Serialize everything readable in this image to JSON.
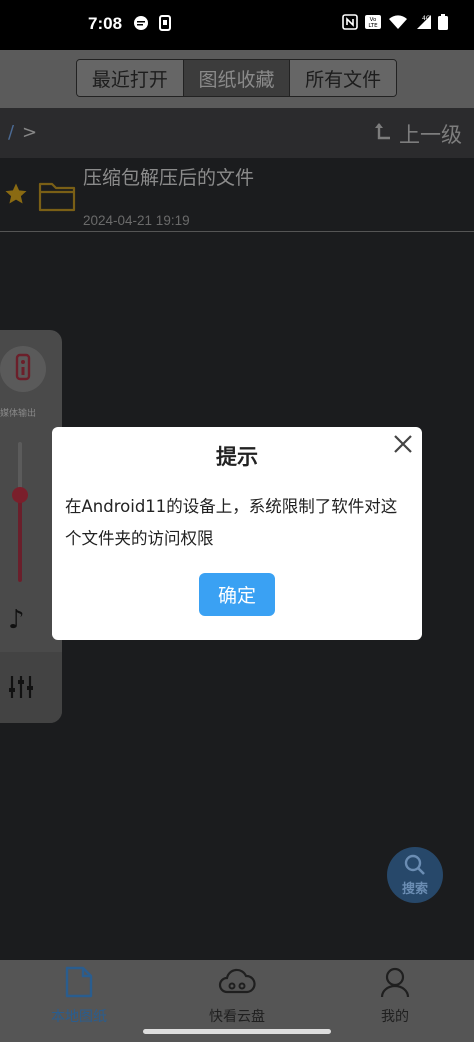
{
  "status_bar": {
    "time": "7:08",
    "network": "4G",
    "lte_badge": "Vo LTE"
  },
  "top_tabs": [
    {
      "label": "最近打开",
      "active": false
    },
    {
      "label": "图纸收藏",
      "active": true
    },
    {
      "label": "所有文件",
      "active": false
    }
  ],
  "path_bar": {
    "root": "/",
    "separator": ">",
    "up_level_label": "上一级"
  },
  "file_list": [
    {
      "name": "压缩包解压后的文件",
      "time": "2024-04-21 19:19",
      "starred": true,
      "icon": "folder-icon"
    }
  ],
  "side_panel": {
    "media_output_label": "媒体输出",
    "volume_level": 0.62
  },
  "fab": {
    "label": "搜索"
  },
  "bottom_nav": [
    {
      "label": "本地图纸",
      "icon": "document-icon",
      "active": true
    },
    {
      "label": "快看云盘",
      "icon": "cloud-icon",
      "active": false
    },
    {
      "label": "我的",
      "icon": "person-icon",
      "active": false
    }
  ],
  "dialog": {
    "title": "提示",
    "message": "在Android11的设备上，系统限制了软件对这个文件夹的访问权限",
    "ok_label": "确定"
  },
  "colors": {
    "accent": "#3aa1f3",
    "star": "#8a6a12",
    "folder": "#7a5f16"
  }
}
